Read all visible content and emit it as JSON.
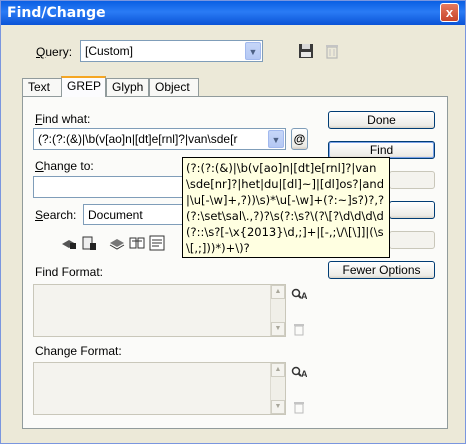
{
  "window": {
    "title": "Find/Change",
    "close_glyph": "x"
  },
  "query": {
    "label_u": "Q",
    "label_rest": "uery:",
    "value": "[Custom]"
  },
  "tabs": [
    {
      "label": "Text",
      "active": false
    },
    {
      "label": "GREP",
      "active": true
    },
    {
      "label": "Glyph",
      "active": false
    },
    {
      "label": "Object",
      "active": false
    }
  ],
  "find_what": {
    "label_u": "F",
    "label_rest": "ind what:",
    "value": "(?:(?:(&)|\\b(v[ao]n|[dt]e[rnl]?|van\\sde[r",
    "special_char": "@"
  },
  "change_to": {
    "label_u": "C",
    "label_rest": "hange to:"
  },
  "search": {
    "label_u": "S",
    "label_rest": "earch:",
    "value": "Document"
  },
  "find_format": {
    "label": "Find Format:"
  },
  "change_format": {
    "label": "Change Format:"
  },
  "buttons": {
    "done": "Done",
    "find": "Find",
    "fewer_options": "Fewer Options"
  },
  "tooltip": {
    "text": "(?:(?:(&)|\\b(v[ao]n|[dt]e[rnl]?|van\\sde[nr]?|het|du|[dl]~]|[dl]os?|and|\\u[-\\w]+,?))\\s)*\\u[-\\w]+(?:~]s?)?,?(?:\\set\\sal\\.,?)?\\s(?:\\s?\\(?\\[?\\d\\d\\d\\d(?::\\s?[-\\x{2013}\\d,;]+|[-,;\\/\\[\\]]|(\\s\\[,;]))*)+\\)?"
  },
  "colors": {
    "title_bar": "#0A5FE3",
    "window_bg": "#ECE9D8",
    "active_tab_accent": "#F5A623"
  }
}
